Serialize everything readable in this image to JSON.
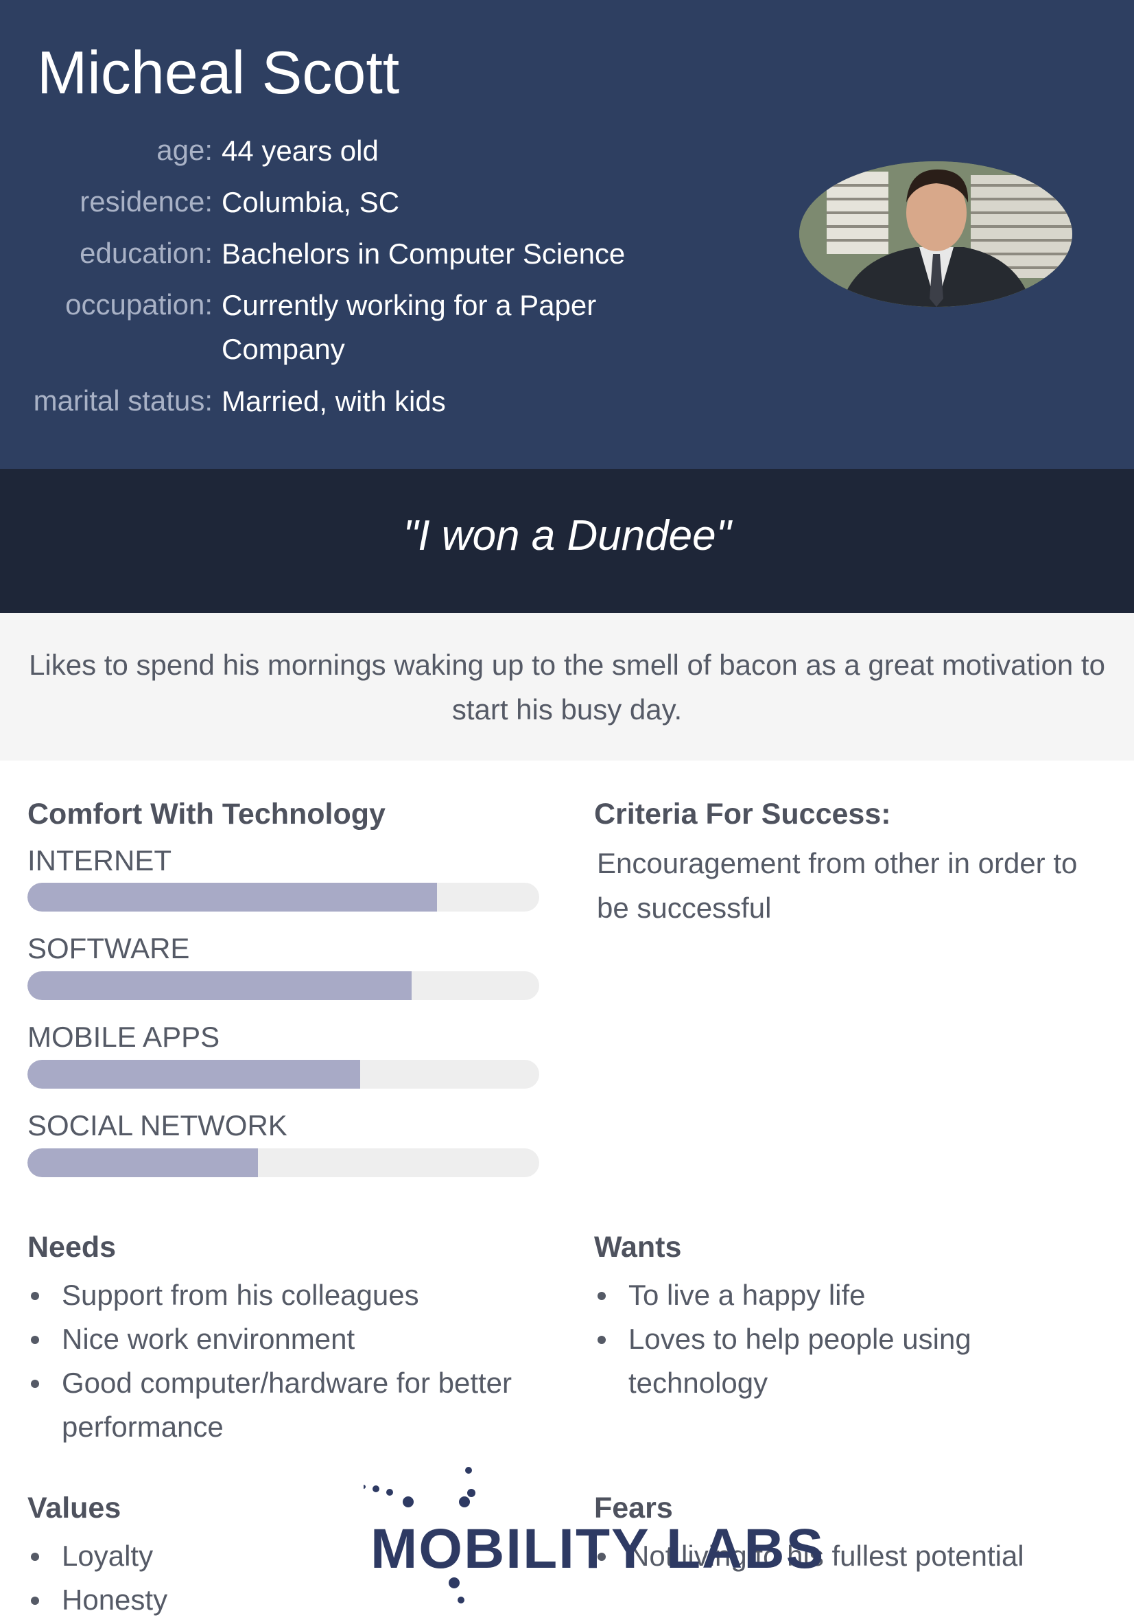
{
  "persona": {
    "name": "Micheal Scott",
    "details": [
      {
        "label": "age:",
        "value": "44 years old"
      },
      {
        "label": "residence:",
        "value": "Columbia, SC"
      },
      {
        "label": "education:",
        "value": "Bachelors in Computer Science"
      },
      {
        "label": "occupation:",
        "value": "Currently working for a Paper Company"
      },
      {
        "label": "marital status:",
        "value": "Married, with kids"
      }
    ],
    "photo_icon": "person-photo-icon"
  },
  "quote": "\"I won a Dundee\"",
  "bio": "Likes to spend his mornings waking up to the smell of bacon as a great motivation to start his busy day.",
  "comfort": {
    "title": "Comfort With Technology",
    "items": [
      {
        "label": "INTERNET",
        "level": 0.8
      },
      {
        "label": "SOFTWARE",
        "level": 0.75
      },
      {
        "label": "MOBILE APPS",
        "level": 0.65
      },
      {
        "label": "SOCIAL NETWORK",
        "level": 0.45
      }
    ]
  },
  "criteria": {
    "title": "Criteria For Success:",
    "text": "Encouragement from other in order to be successful"
  },
  "needs": {
    "title": "Needs",
    "items": [
      "Support from his colleagues",
      "Nice work environment",
      "Good computer/hardware for better performance"
    ]
  },
  "wants": {
    "title": "Wants",
    "items": [
      "To live a happy life",
      "Loves to help people using technology"
    ]
  },
  "values": {
    "title": "Values",
    "items": [
      "Loyalty",
      "Honesty"
    ]
  },
  "fears": {
    "title": "Fears",
    "items": [
      "Not living to his fullest potential"
    ]
  },
  "logo": {
    "text": "MOBILITY LABS",
    "color": "#2e3a63"
  },
  "colors": {
    "header": "#2e3f61",
    "quote_band": "#1e2638",
    "bar_fill": "#a8aac6"
  }
}
